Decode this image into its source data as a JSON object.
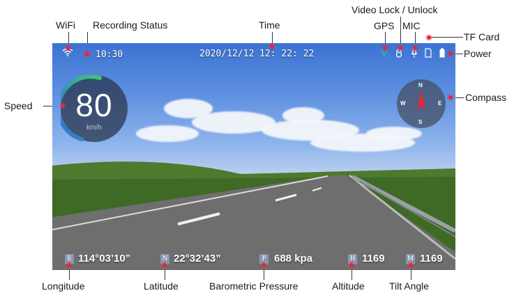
{
  "callouts": {
    "wifi": "WiFi",
    "recording": "Recording Status",
    "time": "Time",
    "video_lock": "Video Lock / Unlock",
    "gps": "GPS",
    "mic": "MIC",
    "tf_card": "TF Card",
    "power": "Power",
    "speed": "Speed",
    "compass": "Compass",
    "longitude": "Longitude",
    "latitude": "Latitude",
    "pressure": "Barometric Pressure",
    "altitude": "Altitude",
    "tilt": "Tilt Angle"
  },
  "screen": {
    "recording_time": "10:30",
    "datetime": "2020/12/12 12: 22: 22",
    "speed": {
      "value": "80",
      "unit": "km/h"
    },
    "compass": {
      "n": "N",
      "e": "E",
      "s": "S",
      "w": "W"
    },
    "readings": {
      "longitude": {
        "badge": "E",
        "value": "114°03’10”"
      },
      "latitude": {
        "badge": "N",
        "value": "22°32’43”"
      },
      "pressure": {
        "badge": "P",
        "value": "688 kpa"
      },
      "altitude": {
        "badge": "H",
        "value": "1169"
      },
      "tilt": {
        "badge": "M",
        "value": "1169"
      }
    }
  },
  "colors": {
    "accent": "#e8263a",
    "gps": "#27b8c9",
    "gauge_start": "#2f6be0",
    "gauge_end": "#3ec96b"
  }
}
